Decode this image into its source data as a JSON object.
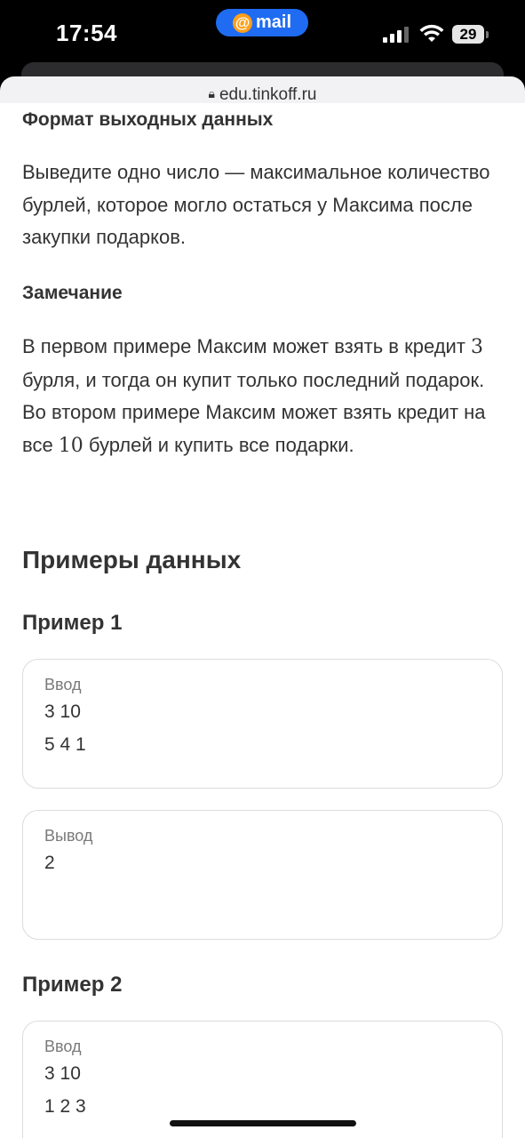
{
  "status_bar": {
    "time": "17:54",
    "app_pill": {
      "icon": "at-sign-icon",
      "label": "mail",
      "color": "#1f6cf2"
    },
    "battery": "29"
  },
  "browser": {
    "url": "edu.tinkoff.ru"
  },
  "page": {
    "output_format_heading": "Формат выходных данных",
    "output_format_text": "Выведите одно число — максимальное количество бурлей, которое могло остаться у Максима после закупки подарков.",
    "note_heading": "Замечание",
    "note_text_1": "В первом примере Максим может взять в кредит",
    "note_num_1": "3",
    "note_text_2": " бурля, и тогда он купит только последний подарок. Во втором примере Максим может взять кредит на все ",
    "note_num_2": "10",
    "note_text_3": " бурлей и купить все подарки.",
    "examples_heading": "Примеры данных",
    "examples": [
      {
        "title": "Пример 1",
        "input_label": "Ввод",
        "input_lines": [
          "3 10",
          "5 4 1"
        ],
        "output_label": "Вывод",
        "output_lines": [
          "2"
        ]
      },
      {
        "title": "Пример 2",
        "input_label": "Ввод",
        "input_lines": [
          "3 10",
          "1 2 3"
        ]
      }
    ]
  }
}
